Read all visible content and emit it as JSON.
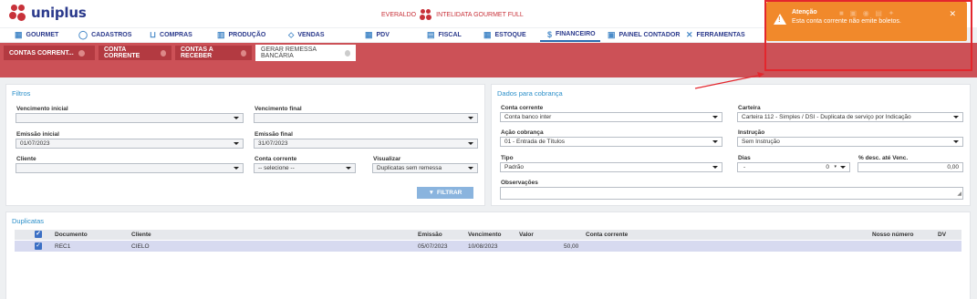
{
  "header": {
    "logo_text": "uniplus",
    "user": "EVERALDO",
    "company": "INTELIDATA GOURMET FULL"
  },
  "nav": [
    {
      "label": "GOURMET",
      "icon": "store-icon"
    },
    {
      "label": "CADASTROS",
      "icon": "circle-icon"
    },
    {
      "label": "COMPRAS",
      "icon": "cart-icon"
    },
    {
      "label": "PRODUÇÃO",
      "icon": "chart-bars-icon"
    },
    {
      "label": "VENDAS",
      "icon": "tag-icon"
    },
    {
      "label": "PDV",
      "icon": "store-icon"
    },
    {
      "label": "FISCAL",
      "icon": "document-icon"
    },
    {
      "label": "ESTOQUE",
      "icon": "table-icon"
    },
    {
      "label": "FINANCEIRO",
      "icon": "dollar-icon"
    },
    {
      "label": "PAINEL CONTADOR",
      "icon": "monitor-icon"
    },
    {
      "label": "FERRAMENTAS",
      "icon": "tools-icon"
    }
  ],
  "tabs": [
    {
      "label": "CONTAS CORRENT..."
    },
    {
      "label": "CONTA CORRENTE"
    },
    {
      "label": "CONTAS A RECEBER"
    },
    {
      "label": "GERAR REMESSA BANCÁRIA"
    }
  ],
  "filtros": {
    "title": "Filtros",
    "vencimento_inicial_label": "Vencimento inicial",
    "vencimento_inicial_value": "",
    "vencimento_final_label": "Vencimento final",
    "vencimento_final_value": "",
    "emissao_inicial_label": "Emissão inicial",
    "emissao_inicial_value": "01/07/2023",
    "emissao_final_label": "Emissão final",
    "emissao_final_value": "31/07/2023",
    "cliente_label": "Cliente",
    "cliente_value": "",
    "conta_corrente_label": "Conta corrente",
    "conta_corrente_value": "-- selecione --",
    "visualizar_label": "Visualizar",
    "visualizar_value": "Duplicatas sem remessa",
    "filtrar_button": "FILTRAR"
  },
  "cobranca": {
    "title": "Dados para cobrança",
    "conta_corrente_label": "Conta corrente",
    "conta_corrente_value": "Conta banco inter",
    "carteira_label": "Carteira",
    "carteira_value": "Carteira 112 - Simples / DSI - Duplicata de serviço por Indicação",
    "acao_label": "Ação cobrança",
    "acao_value": "01 - Entrada de Títulos",
    "instrucao_label": "Instrução",
    "instrucao_value": "Sem Instrução",
    "tipo_label": "Tipo",
    "tipo_value": "Padrão",
    "dias_label": "Dias",
    "dias_sign": "-",
    "dias_value": "0",
    "desc_label": "% desc. até Venc.",
    "desc_value": "0,00",
    "observacoes_label": "Observações",
    "observacoes_value": ""
  },
  "duplicatas": {
    "title": "Duplicatas",
    "columns": [
      "Documento",
      "Cliente",
      "Emissão",
      "Vencimento",
      "Valor",
      "Conta corrente",
      "Nosso número",
      "DV"
    ],
    "rows": [
      {
        "documento": "REC1",
        "cliente": "CIELO",
        "emissao": "05/07/2023",
        "vencimento": "10/08/2023",
        "valor": "50,00",
        "conta_corrente": "",
        "nosso_numero": "",
        "dv": ""
      }
    ]
  },
  "toast": {
    "title": "Atenção",
    "message": "Esta conta corrente não emite boletos.",
    "color": "#f1892b"
  },
  "colors": {
    "brand_red": "#c8323a",
    "brand_blue": "#2b3a8c",
    "tab_band": "#cc5157",
    "annotation": "#e3262d"
  }
}
